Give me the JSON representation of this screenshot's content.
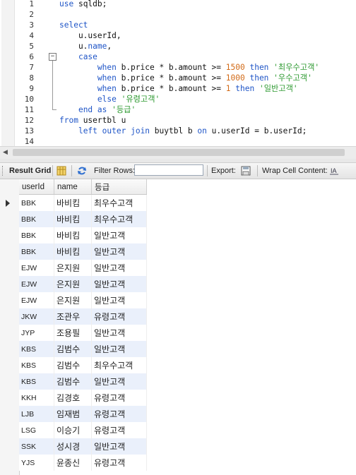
{
  "editor": {
    "line_numbers": [
      "1",
      "2",
      "3",
      "4",
      "5",
      "6",
      "7",
      "8",
      "9",
      "10",
      "11",
      "12",
      "13",
      "14"
    ],
    "lines": [
      [
        {
          "t": "use",
          "k": "kw"
        },
        {
          "t": " sqldb;",
          "k": ""
        }
      ],
      [],
      [
        {
          "t": "select",
          "k": "kw"
        }
      ],
      [
        {
          "t": "    u.userId,",
          "k": ""
        }
      ],
      [
        {
          "t": "    u.",
          "k": ""
        },
        {
          "t": "name",
          "k": "kw"
        },
        {
          "t": ",",
          "k": ""
        }
      ],
      [
        {
          "t": "    ",
          "k": ""
        },
        {
          "t": "case",
          "k": "kw"
        }
      ],
      [
        {
          "t": "        ",
          "k": ""
        },
        {
          "t": "when",
          "k": "kw"
        },
        {
          "t": " b.price * b.amount >= ",
          "k": ""
        },
        {
          "t": "1500",
          "k": "num"
        },
        {
          "t": " ",
          "k": ""
        },
        {
          "t": "then",
          "k": "kw"
        },
        {
          "t": " ",
          "k": ""
        },
        {
          "t": "'최우수고객'",
          "k": "str"
        }
      ],
      [
        {
          "t": "        ",
          "k": ""
        },
        {
          "t": "when",
          "k": "kw"
        },
        {
          "t": " b.price * b.amount >= ",
          "k": ""
        },
        {
          "t": "1000",
          "k": "num"
        },
        {
          "t": " ",
          "k": ""
        },
        {
          "t": "then",
          "k": "kw"
        },
        {
          "t": " ",
          "k": ""
        },
        {
          "t": "'우수고객'",
          "k": "str"
        }
      ],
      [
        {
          "t": "        ",
          "k": ""
        },
        {
          "t": "when",
          "k": "kw"
        },
        {
          "t": " b.price * b.amount >= ",
          "k": ""
        },
        {
          "t": "1",
          "k": "num"
        },
        {
          "t": " ",
          "k": ""
        },
        {
          "t": "then",
          "k": "kw"
        },
        {
          "t": " ",
          "k": ""
        },
        {
          "t": "'일반고객'",
          "k": "str"
        }
      ],
      [
        {
          "t": "        ",
          "k": ""
        },
        {
          "t": "else",
          "k": "kw"
        },
        {
          "t": " ",
          "k": ""
        },
        {
          "t": "'유령고객'",
          "k": "str"
        }
      ],
      [
        {
          "t": "    ",
          "k": ""
        },
        {
          "t": "end",
          "k": "kw"
        },
        {
          "t": " ",
          "k": ""
        },
        {
          "t": "as",
          "k": "kw"
        },
        {
          "t": " ",
          "k": ""
        },
        {
          "t": "'등급'",
          "k": "str"
        }
      ],
      [
        {
          "t": "from",
          "k": "kw"
        },
        {
          "t": " usertbl u",
          "k": ""
        }
      ],
      [
        {
          "t": "    ",
          "k": ""
        },
        {
          "t": "left",
          "k": "kw"
        },
        {
          "t": " ",
          "k": ""
        },
        {
          "t": "outer",
          "k": "kw"
        },
        {
          "t": " ",
          "k": ""
        },
        {
          "t": "join",
          "k": "kw"
        },
        {
          "t": " buytbl b ",
          "k": ""
        },
        {
          "t": "on",
          "k": "kw"
        },
        {
          "t": " u.userId = b.userId;",
          "k": ""
        }
      ],
      []
    ],
    "fold_open_symbol": "−"
  },
  "toolbar": {
    "result_grid_label": "Result Grid",
    "filter_rows_label": "Filter Rows:",
    "filter_value": "",
    "export_label": "Export:",
    "wrap_label": "Wrap Cell Content:"
  },
  "grid": {
    "columns": [
      "userId",
      "name",
      "등급"
    ],
    "rows": [
      [
        "BBK",
        "바비킴",
        "최우수고객"
      ],
      [
        "BBK",
        "바비킴",
        "최우수고객"
      ],
      [
        "BBK",
        "바비킴",
        "일반고객"
      ],
      [
        "BBK",
        "바비킴",
        "일반고객"
      ],
      [
        "EJW",
        "은지원",
        "일반고객"
      ],
      [
        "EJW",
        "은지원",
        "일반고객"
      ],
      [
        "EJW",
        "은지원",
        "일반고객"
      ],
      [
        "JKW",
        "조관우",
        "유령고객"
      ],
      [
        "JYP",
        "조용필",
        "일반고객"
      ],
      [
        "KBS",
        "김범수",
        "일반고객"
      ],
      [
        "KBS",
        "김범수",
        "최우수고객"
      ],
      [
        "KBS",
        "김범수",
        "일반고객"
      ],
      [
        "KKH",
        "김경호",
        "유령고객"
      ],
      [
        "LJB",
        "임재범",
        "유령고객"
      ],
      [
        "LSG",
        "이승기",
        "유령고객"
      ],
      [
        "SSK",
        "성시경",
        "일반고객"
      ],
      [
        "YJS",
        "윤종신",
        "유령고객"
      ]
    ],
    "selected_row": 0
  }
}
